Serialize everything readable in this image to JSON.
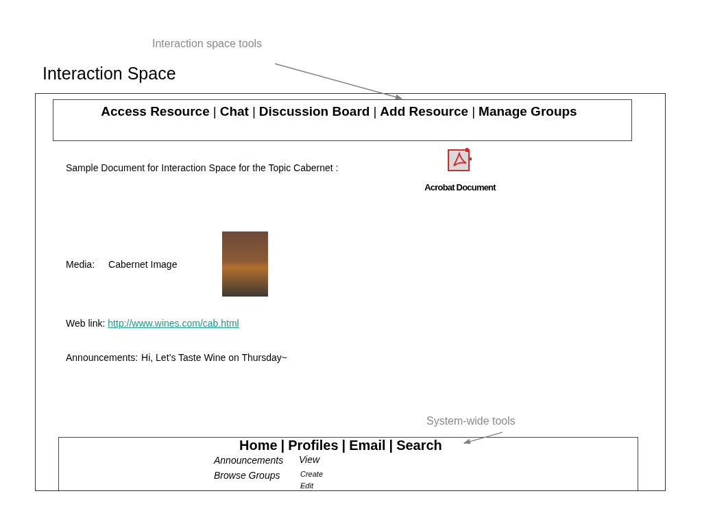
{
  "annotations": [
    {
      "text": "Interaction space tools"
    },
    {
      "text": "System-wide tools"
    }
  ],
  "title": "Interaction Space",
  "tool_bar": {
    "separator": "|",
    "items": [
      {
        "label": "Access Resource"
      },
      {
        "label": "Chat"
      },
      {
        "label": "Discussion Board"
      },
      {
        "label": "Add Resource"
      },
      {
        "label": "Manage Groups"
      }
    ]
  },
  "document": {
    "label": "Sample Document for Interaction Space for the Topic Cabernet :",
    "file_label": "Acrobat Document"
  },
  "media": {
    "label": "Media:",
    "name": "Cabernet Image"
  },
  "web_link": {
    "label": "Web link:",
    "url": "http://www.wines.com/cab.html"
  },
  "announcement": {
    "label": "Announcements:",
    "text": "Hi, Let’s Taste Wine on Thursday~"
  },
  "system_bar": {
    "separator": "|",
    "items": [
      {
        "label": "Home"
      },
      {
        "label": "Profiles"
      },
      {
        "label": "Email"
      },
      {
        "label": "Search"
      }
    ],
    "submenus": [
      {
        "label": "Announcements",
        "options": [
          {
            "label": "View",
            "kind": "primary"
          }
        ]
      },
      {
        "label": "Browse Groups",
        "options": [
          {
            "label": "Create",
            "kind": "secondary"
          },
          {
            "label": "Edit",
            "kind": "secondary"
          }
        ]
      }
    ]
  }
}
